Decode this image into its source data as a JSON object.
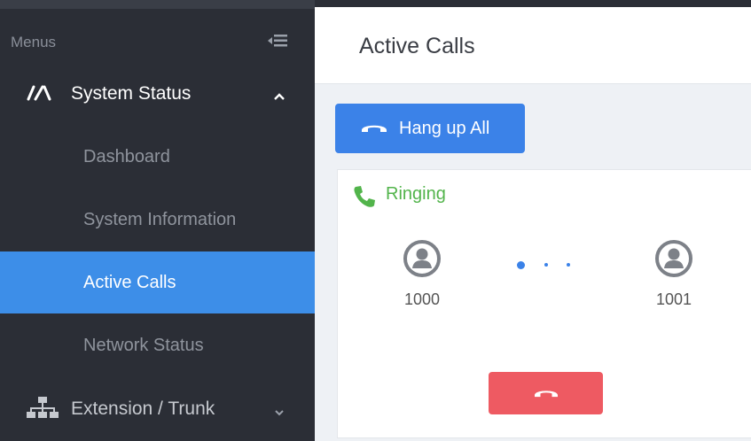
{
  "sidebar": {
    "menus_label": "Menus",
    "groups": [
      {
        "label": "System Status",
        "expanded": true,
        "items": [
          "Dashboard",
          "System Information",
          "Active Calls",
          "Network Status"
        ]
      },
      {
        "label": "Extension / Trunk",
        "expanded": false
      }
    ],
    "active_item": "Active Calls"
  },
  "main": {
    "title": "Active Calls",
    "hangup_all_label": "Hang up All",
    "call": {
      "status": "Ringing",
      "caller": "1000",
      "callee": "1001"
    }
  },
  "colors": {
    "sidebar_bg": "#2b2e36",
    "accent_blue": "#3d8ee8",
    "ringing_green": "#52b44b",
    "hangup_red": "#ee5a62"
  },
  "icons": {
    "collapse": "menu-collapse-icon",
    "system_status": "speedometer-icon",
    "extension_trunk": "network-tree-icon",
    "hangup": "phone-hangup-icon",
    "ringing": "phone-icon",
    "user": "user-avatar-icon"
  }
}
